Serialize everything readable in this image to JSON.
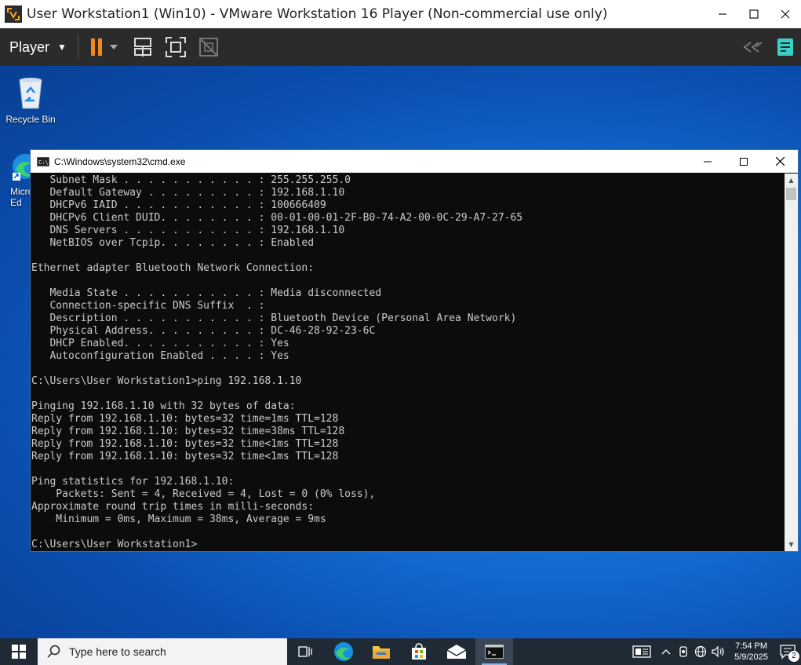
{
  "vmware": {
    "title": "User Workstation1 (Win10) - VMware Workstation 16 Player (Non-commercial use only)",
    "player_menu": "Player",
    "colors": {
      "accent": "#f08a24",
      "toolbar": "#2b2b2b",
      "notes": "#3bd0c5"
    }
  },
  "desktop": {
    "icons": [
      {
        "label": "Recycle Bin",
        "icon": "recycle-bin-icon"
      },
      {
        "label": "Micro\nEd",
        "icon": "microsoft-edge-shortcut-icon"
      }
    ]
  },
  "cmd": {
    "title": "C:\\Windows\\system32\\cmd.exe",
    "lines": [
      "   Subnet Mask . . . . . . . . . . . : 255.255.255.0",
      "   Default Gateway . . . . . . . . . : 192.168.1.10",
      "   DHCPv6 IAID . . . . . . . . . . . : 100666409",
      "   DHCPv6 Client DUID. . . . . . . . : 00-01-00-01-2F-B0-74-A2-00-0C-29-A7-27-65",
      "   DNS Servers . . . . . . . . . . . : 192.168.1.10",
      "   NetBIOS over Tcpip. . . . . . . . : Enabled",
      "",
      "Ethernet adapter Bluetooth Network Connection:",
      "",
      "   Media State . . . . . . . . . . . : Media disconnected",
      "   Connection-specific DNS Suffix  . :",
      "   Description . . . . . . . . . . . : Bluetooth Device (Personal Area Network)",
      "   Physical Address. . . . . . . . . : DC-46-28-92-23-6C",
      "   DHCP Enabled. . . . . . . . . . . : Yes",
      "   Autoconfiguration Enabled . . . . : Yes",
      "",
      "C:\\Users\\User Workstation1>ping 192.168.1.10",
      "",
      "Pinging 192.168.1.10 with 32 bytes of data:",
      "Reply from 192.168.1.10: bytes=32 time=1ms TTL=128",
      "Reply from 192.168.1.10: bytes=32 time=38ms TTL=128",
      "Reply from 192.168.1.10: bytes=32 time<1ms TTL=128",
      "Reply from 192.168.1.10: bytes=32 time<1ms TTL=128",
      "",
      "Ping statistics for 192.168.1.10:",
      "    Packets: Sent = 4, Received = 4, Lost = 0 (0% loss),",
      "Approximate round trip times in milli-seconds:",
      "    Minimum = 0ms, Maximum = 38ms, Average = 9ms",
      "",
      "C:\\Users\\User Workstation1>"
    ]
  },
  "taskbar": {
    "search_placeholder": "Type here to search",
    "apps": [
      "task-view-icon",
      "edge-icon",
      "file-explorer-icon",
      "store-icon",
      "mail-icon",
      "cmd-icon"
    ],
    "time": "7:54 PM",
    "date": "5/9/2025",
    "notification_count": "2"
  }
}
